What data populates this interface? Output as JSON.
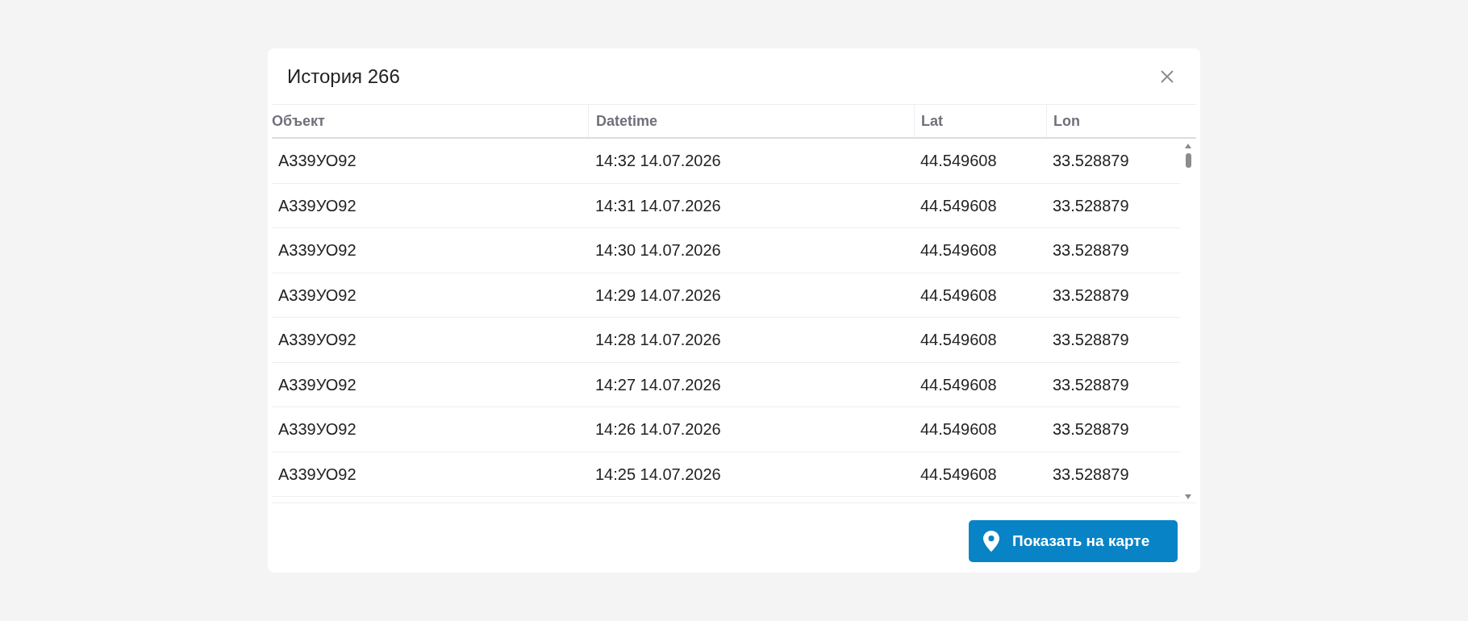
{
  "dialog": {
    "title": "История 266"
  },
  "table": {
    "columns": [
      "Объект",
      "Datetime",
      "Lat",
      "Lon"
    ],
    "rows": [
      [
        "А339УО92",
        "14:32 14.07.2026",
        "44.549608",
        "33.528879"
      ],
      [
        "А339УО92",
        "14:31 14.07.2026",
        "44.549608",
        "33.528879"
      ],
      [
        "А339УО92",
        "14:30 14.07.2026",
        "44.549608",
        "33.528879"
      ],
      [
        "А339УО92",
        "14:29 14.07.2026",
        "44.549608",
        "33.528879"
      ],
      [
        "А339УО92",
        "14:28 14.07.2026",
        "44.549608",
        "33.528879"
      ],
      [
        "А339УО92",
        "14:27 14.07.2026",
        "44.549608",
        "33.528879"
      ],
      [
        "А339УО92",
        "14:26 14.07.2026",
        "44.549608",
        "33.528879"
      ],
      [
        "А339УО92",
        "14:25 14.07.2026",
        "44.549608",
        "33.528879"
      ]
    ]
  },
  "footer": {
    "button": "Показать на карте"
  }
}
